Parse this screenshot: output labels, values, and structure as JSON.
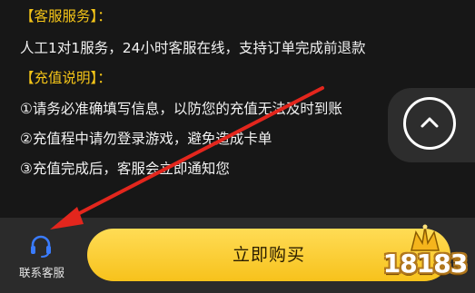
{
  "sections": [
    {
      "heading": "【客服服务】：",
      "lines": [
        "人工1对1服务，24小时客服在线，支持订单完成前退款"
      ]
    },
    {
      "heading": "【充值说明】：",
      "lines": [
        "①请务必准确填写信息，以防您的充值无法及时到账",
        "②充值程中请勿登录游戏，避免造成卡单",
        "③充值完成后，客服会立即通知您"
      ]
    }
  ],
  "scroll_top": {
    "icon": "chevron-up-icon"
  },
  "bottom_bar": {
    "service_label": "联系客服",
    "service_icon": "headset-icon",
    "buy_label": "立即购买"
  },
  "watermark": {
    "text": "18183"
  },
  "colors": {
    "background": "#171717",
    "heading": "#f5c518",
    "accent_button": "#f7c21c",
    "annotation_arrow": "#e3261d",
    "service_icon": "#3a7cff"
  }
}
